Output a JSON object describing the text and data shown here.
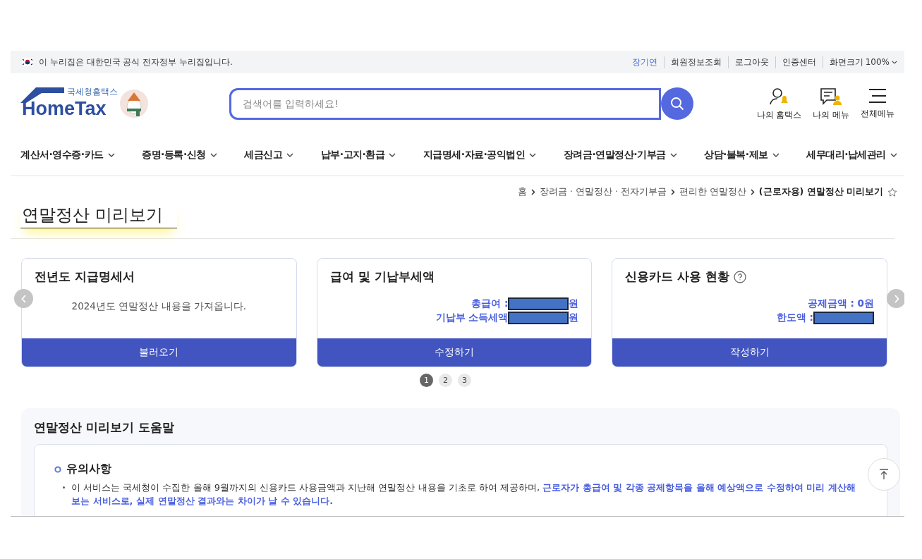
{
  "gov_bar": {
    "notice": "이 누리집은 대한민국 공식 전자정부 누리집입니다.",
    "links": [
      {
        "label": "장기연",
        "selected": true
      },
      {
        "label": "회원정보조회",
        "selected": false
      },
      {
        "label": "로그아웃",
        "selected": false
      },
      {
        "label": "인증센터",
        "selected": false
      }
    ],
    "zoom": {
      "label": "화면크기",
      "value": "100%"
    }
  },
  "header": {
    "logo": {
      "subtitle": "국세청홈택스",
      "title": "HomeTax"
    },
    "search": {
      "placeholder": "검색어를 입력하세요!"
    },
    "tools": [
      {
        "kind": "person",
        "label": "나의 홈택스"
      },
      {
        "kind": "note",
        "label": "나의 메뉴"
      },
      {
        "kind": "menu",
        "label": "전체메뉴"
      }
    ]
  },
  "nav": [
    "계산서·영수증·카드",
    "증명·등록·신청",
    "세금신고",
    "납부·고지·환급",
    "지급명세·자료·공익법인",
    "장려금·연말정산·기부금",
    "상담·불복·제보",
    "세무대리·납세관리"
  ],
  "breadcrumb": [
    "홈",
    "장려금 · 연말정산 · 전자기부금",
    "편리한 연말정산",
    "(근로자용) 연말정산 미리보기"
  ],
  "page_title": "연말정산 미리보기",
  "cards": [
    {
      "kind": "message",
      "title": "전년도 지급명세서",
      "help": false,
      "message": "2024년도 연말정산 내용을 가져옵니다.",
      "button": "불러오기"
    },
    {
      "kind": "amounts",
      "title": "급여 및 기납부세액",
      "help": false,
      "lines": [
        {
          "label": "총급여 :",
          "redacted": true,
          "unit": "원"
        },
        {
          "label": "기납부 소득세액",
          "redacted": true,
          "unit": "원"
        }
      ],
      "button": "수정하기"
    },
    {
      "kind": "amounts",
      "title": "신용카드 사용 현황",
      "help": true,
      "lines": [
        {
          "label": "공제금액 : 0원",
          "redacted": false
        },
        {
          "label": "한도액 :",
          "redacted": true
        }
      ],
      "button": "작성하기"
    }
  ],
  "pages": [
    {
      "label": "1",
      "selected": true
    },
    {
      "label": "2",
      "selected": false
    },
    {
      "label": "3",
      "selected": false
    }
  ],
  "help_section": {
    "title": "연말정산 미리보기 도움말",
    "heading": "유의사항",
    "items": [
      "이 서비스는 국세청이 수집한 올해 9월까지의 신용카드 사용금액과 지난해 연말정산 내용을 기초로 하여 제공하며, **근로자가 총급여 및 각종 공제항목을 올해 예상액으로 수정하여 미리 계산해 보는 서비스로, 실제 연말정산 결과와는 차이가 날 수 있습니다.**"
    ]
  }
}
